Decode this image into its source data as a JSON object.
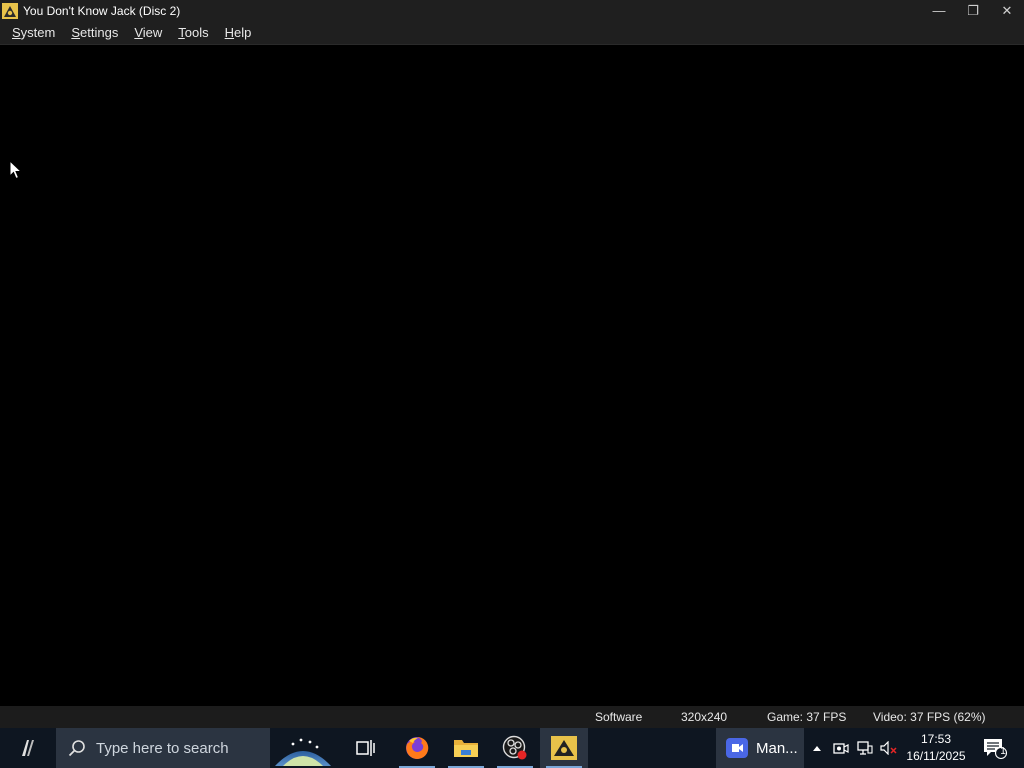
{
  "window": {
    "title": "You Don't Know Jack (Disc 2)",
    "minimize_glyph": "—",
    "maximize_glyph": "❐",
    "close_glyph": "✕"
  },
  "menu": {
    "items": [
      {
        "label": "System",
        "underline": "S",
        "rest": "ystem"
      },
      {
        "label": "Settings",
        "underline": "S",
        "rest": "ettings"
      },
      {
        "label": "View",
        "underline": "V",
        "rest": "iew"
      },
      {
        "label": "Tools",
        "underline": "T",
        "rest": "ools"
      },
      {
        "label": "Help",
        "underline": "H",
        "rest": "elp"
      }
    ]
  },
  "status": {
    "renderer": "Software",
    "resolution": "320x240",
    "game_fps": "Game: 37 FPS",
    "video_fps": "Video: 37 FPS (62%)"
  },
  "taskbar": {
    "search_placeholder": "Type here to search",
    "meet_label": "Man...",
    "time": "17:53",
    "date": "16/11/2025",
    "notification_count": "1"
  },
  "colors": {
    "titlebar": "#1f1f1f",
    "statusbar": "#1c1c1c",
    "taskbar": "#0e1621",
    "taskbar_search": "#2b3441"
  }
}
